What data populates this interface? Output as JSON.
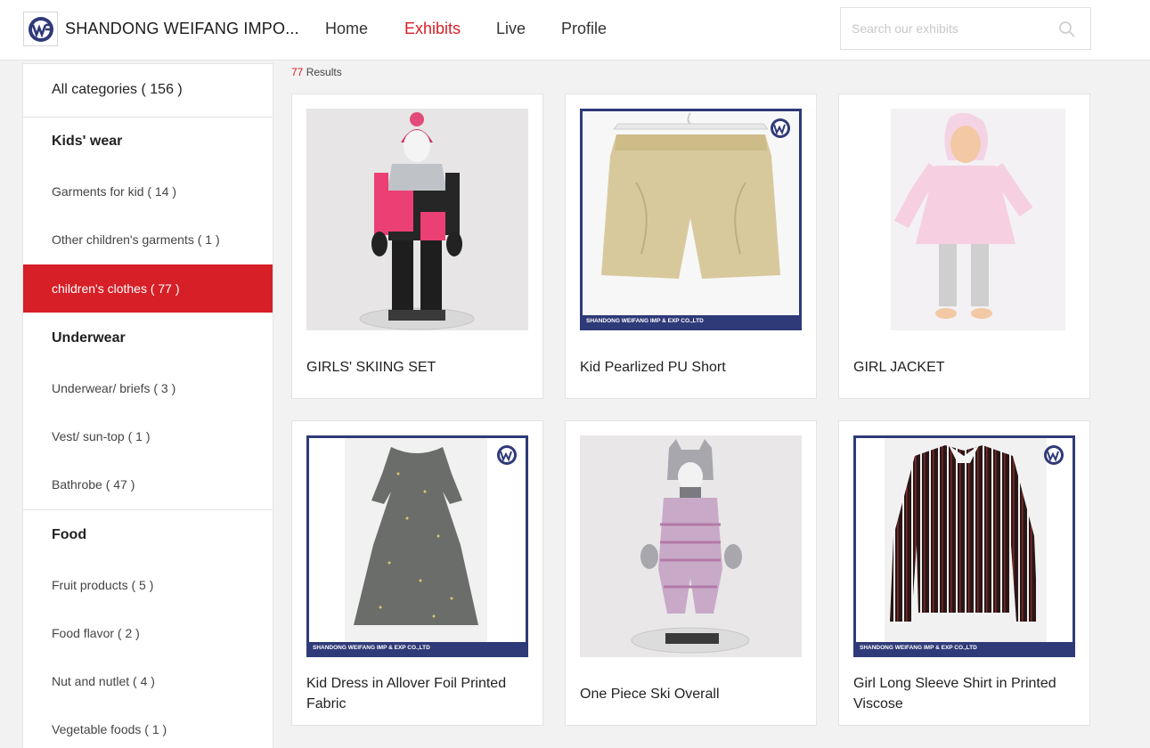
{
  "header": {
    "brand": "SHANDONG WEIFANG IMPO...",
    "nav": [
      "Home",
      "Exhibits",
      "Live",
      "Profile"
    ],
    "active_nav": "Exhibits",
    "search_placeholder": "Search our exhibits"
  },
  "sidebar": {
    "all": "All categories ( 156 )",
    "groups": [
      {
        "title": "Kids' wear",
        "items": [
          "Garments for kid ( 14 )",
          "Other children's garments ( 1 )",
          "children's clothes ( 77 )"
        ]
      },
      {
        "title": "Underwear",
        "items": [
          "Underwear/ briefs ( 3 )",
          "Vest/ sun-top ( 1 )",
          "Bathrobe ( 47 )"
        ]
      },
      {
        "title": "Food",
        "items": [
          "Fruit products ( 5 )",
          "Food flavor ( 2 )",
          "Nut and nutlet ( 4 )",
          "Vegetable foods ( 1 )"
        ]
      }
    ],
    "active_item": "children's clothes ( 77 )"
  },
  "results": {
    "count": "77",
    "label": "Results"
  },
  "products": [
    {
      "name": "GIRLS' SKIING SET",
      "icon": "ski-set-photo"
    },
    {
      "name": "Kid Pearlized PU Short",
      "icon": "pu-short-photo",
      "watermark": "SHANDONG WEIFANG IMP & EXP CO.,LTD"
    },
    {
      "name": "GIRL JACKET",
      "icon": "girl-jacket-photo"
    },
    {
      "name": "Kid Dress in Allover Foil Printed Fabric",
      "icon": "dress-photo",
      "watermark": "SHANDONG WEIFANG IMP & EXP CO.,LTD"
    },
    {
      "name": "One Piece Ski Overall",
      "icon": "ski-overall-photo"
    },
    {
      "name": "Girl Long Sleeve Shirt in Printed Viscose",
      "icon": "striped-shirt-photo",
      "watermark": "SHANDONG WEIFANG IMP & EXP CO.,LTD"
    }
  ],
  "colors": {
    "accent": "#d61f26",
    "frame": "#2f3a78"
  }
}
